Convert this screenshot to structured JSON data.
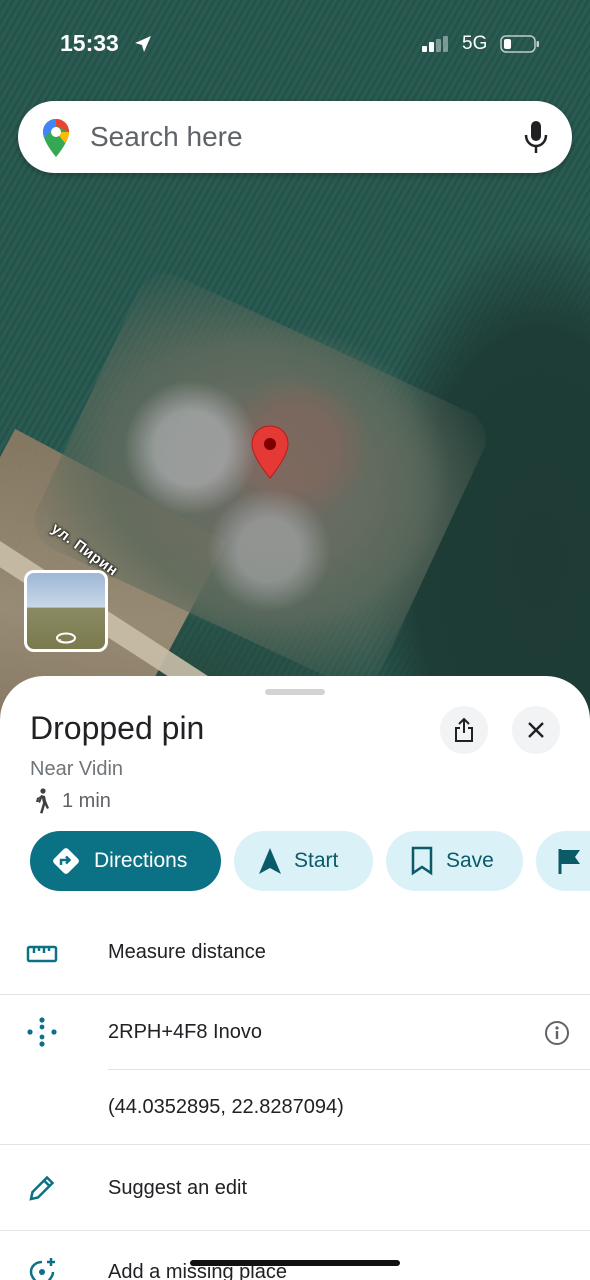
{
  "status_bar": {
    "time": "15:33",
    "network": "5G"
  },
  "search": {
    "placeholder": "Search here",
    "icons": {
      "logo": "google-maps-pin-logo",
      "mic": "microphone-icon"
    }
  },
  "map": {
    "street_label": "ул. Пирин",
    "marker_color": "#e53935"
  },
  "place": {
    "title": "Dropped pin",
    "subtitle": "Near Vidin",
    "walk_time": "1 min"
  },
  "actions": [
    {
      "label": "Directions",
      "icon": "directions-icon"
    },
    {
      "label": "Start",
      "icon": "navigation-arrow-icon"
    },
    {
      "label": "Save",
      "icon": "bookmark-icon"
    },
    {
      "label": "",
      "icon": "flag-icon"
    }
  ],
  "details": {
    "measure": "Measure distance",
    "plus_code": "2RPH+4F8 Inovo",
    "coordinates": "(44.0352895, 22.8287094)",
    "suggest_edit": "Suggest an edit",
    "add_place": "Add a missing place"
  },
  "colors": {
    "accent": "#0b7285",
    "chip_bg": "#d9f1f7",
    "text": "#202124",
    "muted": "#70757a"
  }
}
